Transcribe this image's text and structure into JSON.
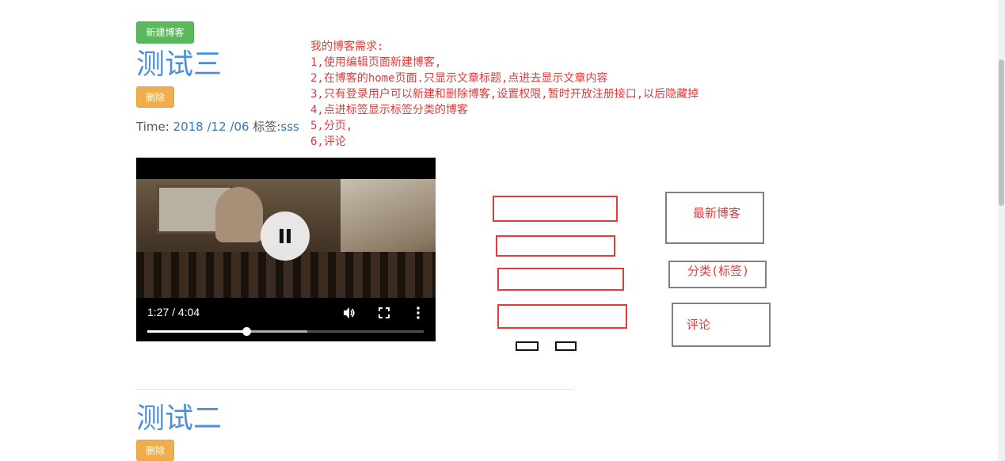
{
  "toolbar": {
    "new_blog_label": "新建博客"
  },
  "posts": [
    {
      "title": "测试三",
      "delete_label": "删除",
      "meta_time_label": "Time:",
      "meta_date": "2018 /12 /06",
      "meta_tag_label": "标签:",
      "meta_tag": "sss"
    },
    {
      "title": "测试二",
      "delete_label": "删除"
    }
  ],
  "notes": [
    "我的博客需求:",
    "1,使用编辑页面新建博客,",
    "2,在博客的home页面.只显示文章标题,点进去显示文章内容",
    "3,只有登录用户可以新建和删除博客,设置权限,暂时开放注册接口,以后隐藏掉",
    "4,点进标签显示标签分类的博客",
    "5,分页,",
    "6,评论"
  ],
  "video": {
    "time_display": "1:27 / 4:04",
    "progress_fraction": 0.359,
    "buffered_fraction": 0.578,
    "state_icon": "pause-icon",
    "volume_icon": "volume-icon",
    "fullscreen_icon": "fullscreen-icon",
    "more_icon": "more-vertical-icon"
  },
  "sketch": {
    "latest_label": "最新博客",
    "category_label": "分类(标签)",
    "comment_label": "评论"
  },
  "colors": {
    "title_blue": "#4a90e2",
    "success_green": "#5cb85c",
    "warning_orange": "#f0ad4e",
    "note_red": "#e03c3c",
    "link_blue": "#337ab7"
  }
}
